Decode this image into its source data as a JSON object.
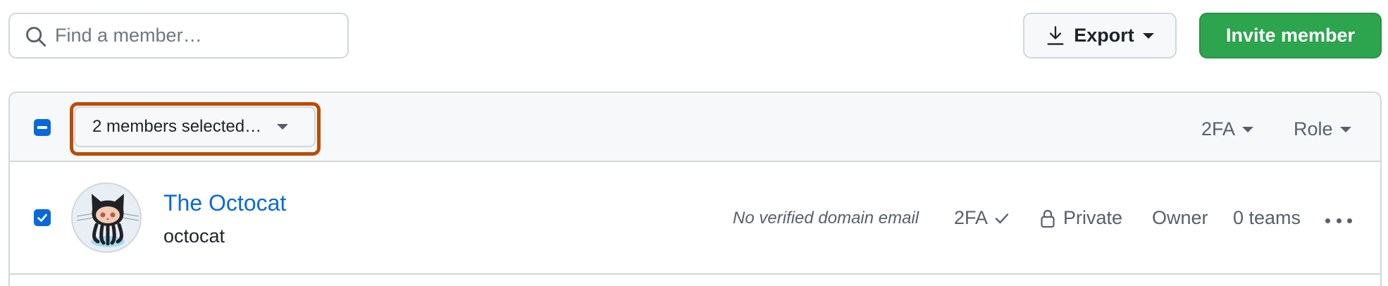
{
  "search": {
    "placeholder": "Find a member…",
    "icon": "search-icon"
  },
  "toolbar": {
    "export_label": "Export",
    "invite_label": "Invite member",
    "invite_color": "#2da44e"
  },
  "table_header": {
    "selected_label": "2 members selected…",
    "filters": [
      "2FA",
      "Role"
    ],
    "highlight_color": "#bc4c00"
  },
  "members": [
    {
      "display_name": "The Octocat",
      "login": "octocat",
      "email_status": "No verified domain email",
      "twofa_label": "2FA",
      "visibility": "Private",
      "role": "Owner",
      "teams": "0 teams",
      "selected": true
    }
  ],
  "colors": {
    "accent": "#0969da",
    "border": "#d0d7de",
    "muted": "#57606a"
  }
}
